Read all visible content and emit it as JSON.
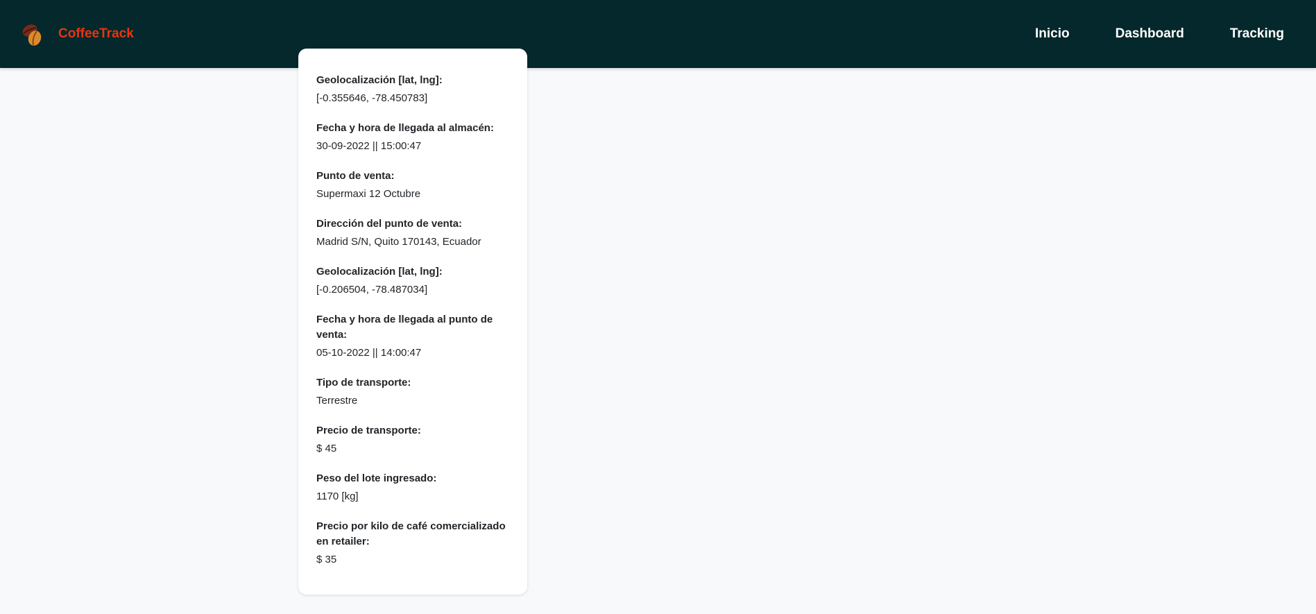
{
  "header": {
    "brand_name": "CoffeeTrack",
    "brand_color": "#e8350f",
    "background_color": "#04282c",
    "logo_icon": "coffee-beans-icon",
    "nav": [
      {
        "label": "Inicio"
      },
      {
        "label": "Dashboard"
      },
      {
        "label": "Tracking"
      }
    ]
  },
  "details": [
    {
      "label": "Geolocalización [lat, lng]:",
      "value": "[-0.355646, -78.450783]"
    },
    {
      "label": "Fecha y hora de llegada al almacén:",
      "value": "30-09-2022 || 15:00:47"
    },
    {
      "label": "Punto de venta:",
      "value": "Supermaxi 12 Octubre"
    },
    {
      "label": "Dirección del punto de venta:",
      "value": "Madrid S/N, Quito 170143, Ecuador"
    },
    {
      "label": "Geolocalización [lat, lng]:",
      "value": "[-0.206504, -78.487034]"
    },
    {
      "label": "Fecha y hora de llegada al punto de venta:",
      "value": "05-10-2022 || 14:00:47"
    },
    {
      "label": "Tipo de transporte:",
      "value": "Terrestre"
    },
    {
      "label": "Precio de transporte:",
      "value": "$ 45"
    },
    {
      "label": "Peso del lote ingresado:",
      "value": "1170 [kg]"
    },
    {
      "label": "Precio por kilo de café comercializado en retailer:",
      "value": "$ 35"
    }
  ]
}
